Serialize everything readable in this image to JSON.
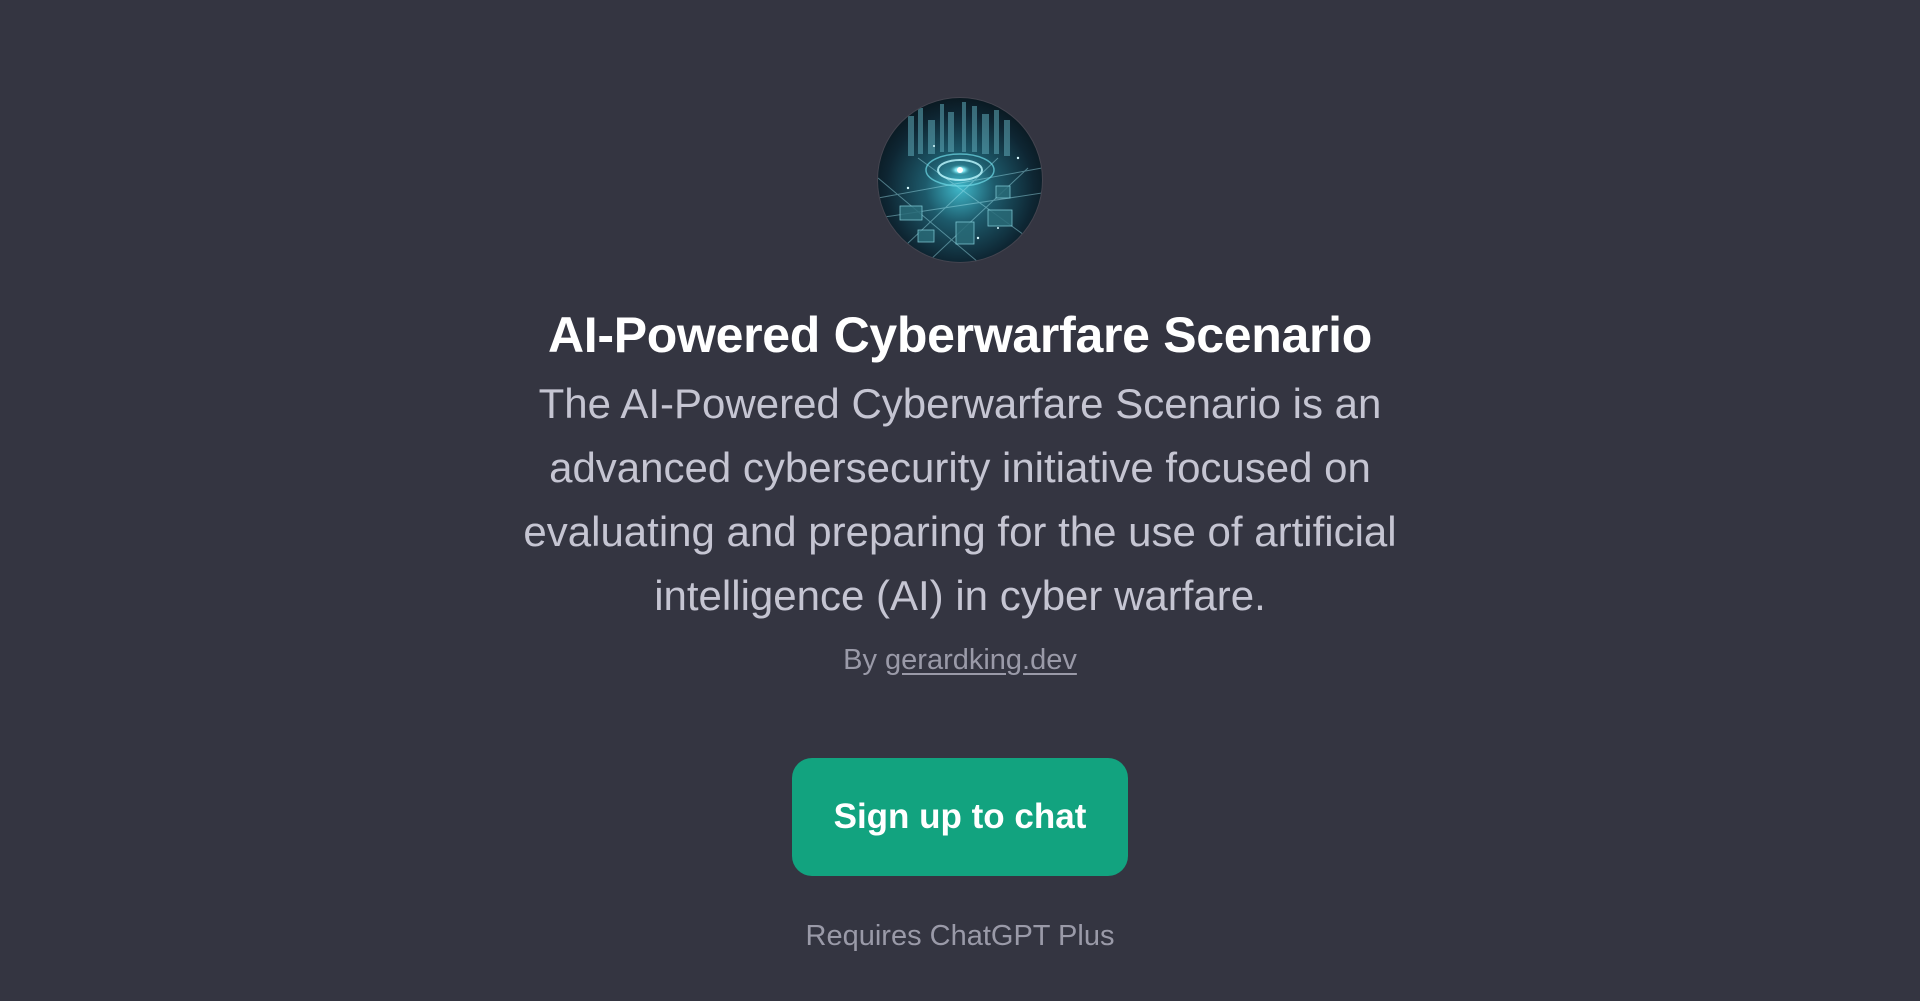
{
  "gpt": {
    "avatar_icon": "cyber-city-circuit-icon",
    "title": "AI-Powered Cyberwarfare Scenario",
    "description": "The AI-Powered Cyberwarfare Scenario is an advanced cybersecurity initiative focused on evaluating and preparing for the use of artificial intelligence (AI) in cyber warfare.",
    "by_prefix": "By",
    "author": "gerardking.dev"
  },
  "cta": {
    "label": "Sign up to chat",
    "color": "#12a37f"
  },
  "footer": {
    "requires": "Requires ChatGPT Plus"
  },
  "theme": {
    "background": "#343541"
  }
}
